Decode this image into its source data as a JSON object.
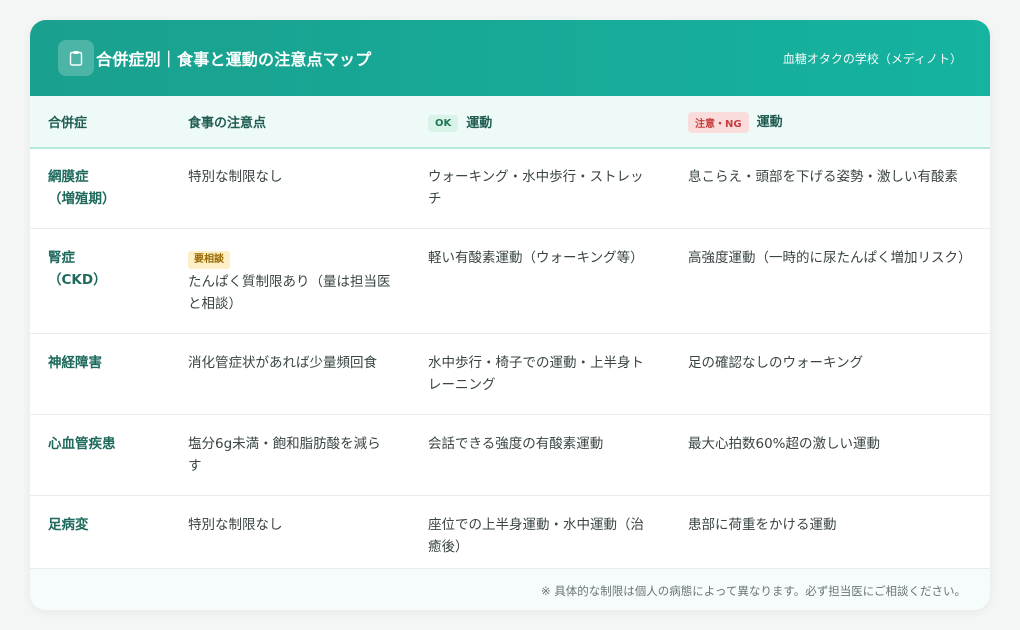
{
  "header": {
    "title": "合併症別｜食事と運動の注意点マップ",
    "brand": "血糖オタクの学校（メディノト）",
    "icon": "clipboard-icon"
  },
  "table": {
    "headers": {
      "condition": "合併症",
      "diet": "食事の注意点",
      "ok_pill": "OK",
      "ok_label": "運動",
      "ng_pill": "注意・NG",
      "ng_label": "運動"
    },
    "rows": [
      {
        "condition": "網膜症",
        "condition_sub": "（増殖期）",
        "diet_badge": "",
        "diet": "特別な制限なし",
        "ok": "ウォーキング・水中歩行・ストレッチ",
        "ng": "息こらえ・頭部を下げる姿勢・激しい有酸素"
      },
      {
        "condition": "腎症",
        "condition_sub": "（CKD）",
        "diet_badge": "要相談",
        "diet": "たんぱく質制限あり（量は担当医と相談）",
        "ok": "軽い有酸素運動（ウォーキング等）",
        "ng": "高強度運動（一時的に尿たんぱく増加リスク）"
      },
      {
        "condition": "神経障害",
        "condition_sub": "",
        "diet_badge": "",
        "diet": "消化管症状があれば少量頻回食",
        "ok": "水中歩行・椅子での運動・上半身トレーニング",
        "ng": "足の確認なしのウォーキング"
      },
      {
        "condition": "心血管疾患",
        "condition_sub": "",
        "diet_badge": "",
        "diet": "塩分6g未満・飽和脂肪酸を減らす",
        "ok": "会話できる強度の有酸素運動",
        "ng": "最大心拍数60%超の激しい運動"
      },
      {
        "condition": "足病変",
        "condition_sub": "",
        "diet_badge": "",
        "diet": "特別な制限なし",
        "ok": "座位での上半身運動・水中運動（治癒後）",
        "ng": "患部に荷重をかける運動"
      }
    ]
  },
  "footer": {
    "note": "※ 具体的な制限は個人の病態によって異なります。必ず担当医にご相談ください。"
  },
  "colors": {
    "header_start": "#1aa08e",
    "header_end": "#15b3a0",
    "condition_text": "#1e6a5d",
    "ok_pill_bg": "#d9f3e8",
    "ng_pill_bg": "#fbdcdc",
    "consult_badge_bg": "#fdf0c6"
  }
}
